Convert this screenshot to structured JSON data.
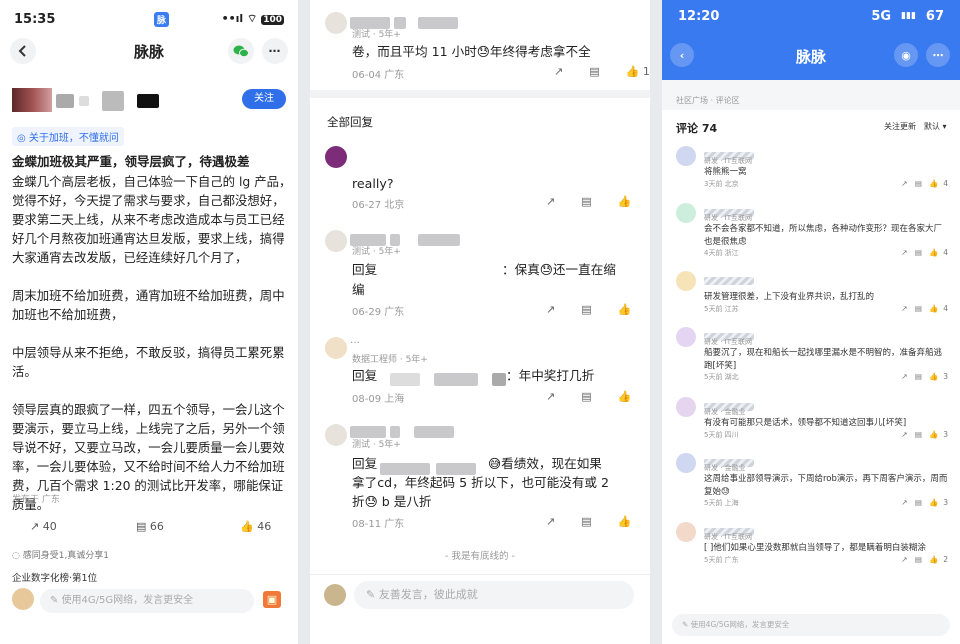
{
  "panel1": {
    "status": {
      "time": "15:35",
      "app_badge": "脉",
      "signal": "••ıl",
      "wifi": "⌔",
      "battery": "100"
    },
    "nav": {
      "title": "脉脉"
    },
    "follow": "关注",
    "tag": "关于加班，不懂就问",
    "title": "金蝶加班极其严重，领导层疯了，待遇极差",
    "body": "金蝶几个高层老板，自己体验一下自己的 lg 产品，觉得不好，今天提了需求与要求，自己都没想好，要求第二天上线，从来不考虑改造成本与员工已经好几个月熬夜加班通宵达旦发版，要求上线，搞得大家通宵去改发版，已经连续好几个月了，\n\n周末加班不给加班费，通宵加班不给加班费，周中加班也不给加班费，\n\n中层领导从来不拒绝，不敢反驳，搞得员工累死累活。\n\n领导层真的跟疯了一样，四五个领导，一会儿这个要演示，要立马上线，上线完了之后，另外一个领导说不好，又要立马改，一会儿要质量一会儿要效率，一会儿要体验，又不给时间不给人力不给加班费，几百个需求 1:20 的测试比开发率，哪能保证质量。",
    "meta": "发布于 广东",
    "actions": {
      "share": "40",
      "comment": "66",
      "like": "46"
    },
    "empathy": "感同身受1,真诚分享1",
    "rank": "企业数字化榜·第1位",
    "input_placeholder": "使用4G/5G网络，发言更安全"
  },
  "panel2": {
    "top_reply": {
      "sub": "测试 · 5年+",
      "text": "卷，而且平均 11 小时😓年终得考虑拿不全",
      "meta": "06-04 广东",
      "like": "1"
    },
    "section": "全部回复",
    "replies": [
      {
        "sub": "",
        "line1": "really?",
        "line2": "",
        "meta": "06-27 北京"
      },
      {
        "sub": "测试 · 5年+",
        "line1": "回复",
        "line1b": "：保真😓还一直在缩",
        "line2": "编",
        "meta": "06-29 广东"
      },
      {
        "sub": "数据工程师 · 5年+",
        "line1": "回复",
        "line1b": "：年中奖打几折",
        "line2": "",
        "meta": "08-09 上海"
      },
      {
        "sub": "测试 · 5年+",
        "line1": "回复",
        "line1b": "😅看绩效，现在如果",
        "line2": "拿了cd，年终起码 5 折以下，也可能没有或 2",
        "line3": "折😓 b 是八折",
        "meta": "08-11 广东"
      }
    ],
    "end": "- 我是有底线的 -",
    "input_placeholder": "友善发言，彼此成就"
  },
  "panel3": {
    "status": {
      "time": "12:20",
      "network": "5G",
      "signal": "▮▮▮",
      "battery": "67"
    },
    "nav": {
      "title": "脉脉"
    },
    "crumb": "社区广场 · 评论区",
    "count": "评论 74",
    "sort1": "关注更新",
    "sort2": "默认 ▾",
    "comments": [
      {
        "sub": "研发 · IT互联网",
        "text": "将熊熊一窝",
        "time": "3天前  北京",
        "likes": "4",
        "color": "#cfd8f0"
      },
      {
        "sub": "研发 · IT互联网",
        "text": "会不会各家都不知道，所以焦虑，各种动作变形？现在各家大厂也是很焦虑",
        "time": "4天前  浙江",
        "likes": "4",
        "color": "#cdeedd"
      },
      {
        "sub": "",
        "text": "研发管理很差，上下没有业界共识，乱打乱的",
        "time": "5天前  江苏",
        "likes": "4",
        "color": "#f6e3b8"
      },
      {
        "sub": "研发 · IT互联网",
        "text": "船要沉了，现在和船长一起找哪里漏水是不明智的，准备弃船逃跑[坏笑]",
        "time": "5天前  湖北",
        "likes": "3",
        "color": "#e4d6f2"
      },
      {
        "sub": "研发 · 金融业",
        "text": "有没有可能那只是话术，领导都不知道这回事儿[坏笑]",
        "time": "5天前  四川",
        "likes": "3",
        "color": "#e6d5ef"
      },
      {
        "sub": "研发 · 金融业",
        "text": "这周给事业部领导演示，下周给rob演示，再下周客户演示，周而复始😓",
        "time": "5天前  上海",
        "likes": "3",
        "color": "#cfd8f0"
      },
      {
        "sub": "研发 · IT互联网",
        "text": "[ ]他们如果心里没数那就白当领导了，都是瞒着明白装糊涂",
        "time": "5天前  广东",
        "likes": "2",
        "color": "#f3d9c9"
      }
    ],
    "input_placeholder": "使用4G/5G网络，发言更安全"
  }
}
